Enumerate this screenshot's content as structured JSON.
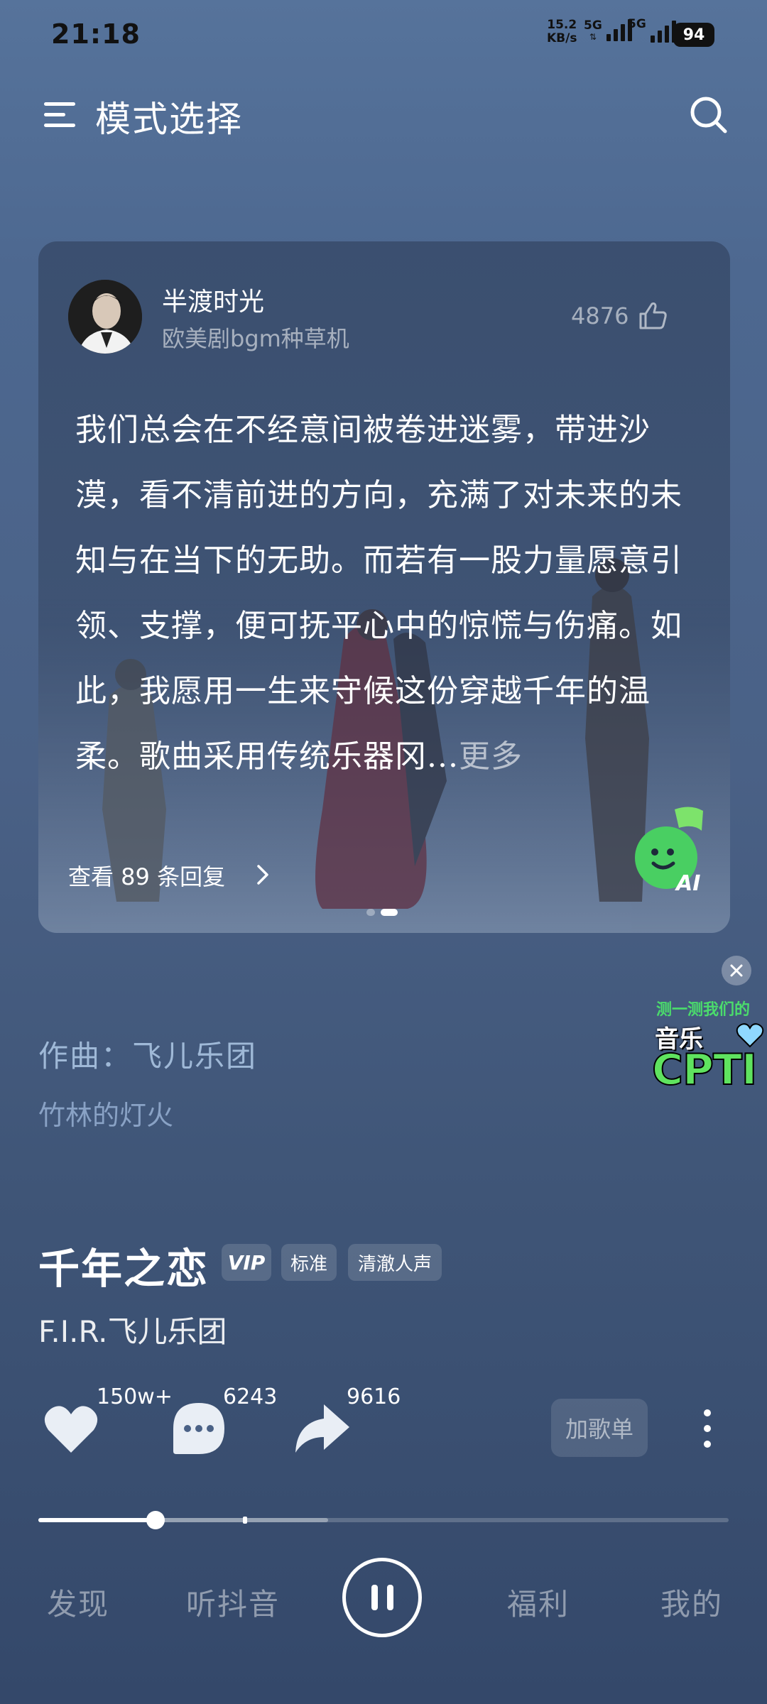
{
  "status_bar": {
    "time": "21:18",
    "net_speed": "15.2",
    "net_unit": "KB/s",
    "network1": "5G",
    "network2": "5G",
    "battery": "94"
  },
  "header": {
    "title": "模式选择",
    "menu_icon": "menu-icon",
    "search_icon": "search-icon"
  },
  "comment_card": {
    "username": "半渡时光",
    "subtitle": "欧美剧bgm种草机",
    "like_count": "4876",
    "text": "我们总会在不经意间被卷进迷雾，带进沙漠，看不清前进的方向，充满了对未来的未知与在当下的无助。而若有一股力量愿意引领、支撑，便可抚平心中的惊慌与伤痛。如此，我愿用一生来守候这份穿越千年的温柔。歌曲采用传统乐器冈...",
    "more_label": "更多",
    "replies_label": "查看 89 条回复",
    "page_indicator": {
      "count": 2,
      "active": 2
    }
  },
  "floating_ad": {
    "line1": "测一测我们的",
    "line2": "音乐",
    "line3": "CPTI"
  },
  "credits": {
    "composer": "作曲：飞儿乐团",
    "lyric_line": "竹林的灯火"
  },
  "song": {
    "title": "千年之恋",
    "tags": [
      "VIP",
      "标准",
      "清澈人声"
    ],
    "artist": "F.I.R.飞儿乐团"
  },
  "actions": {
    "like_count": "150w+",
    "comment_count": "6243",
    "share_count": "9616",
    "add_playlist_label": "加歌单"
  },
  "progress": {
    "played_fraction": 0.17,
    "buffered_fraction": 0.42
  },
  "bottom_nav": {
    "items": [
      "发现",
      "听抖音",
      "福利",
      "我的"
    ],
    "play_state": "pause-icon"
  },
  "colors": {
    "background_top": "#56739b",
    "background_bottom": "#34486a",
    "ad_green": "#5fe35f"
  }
}
